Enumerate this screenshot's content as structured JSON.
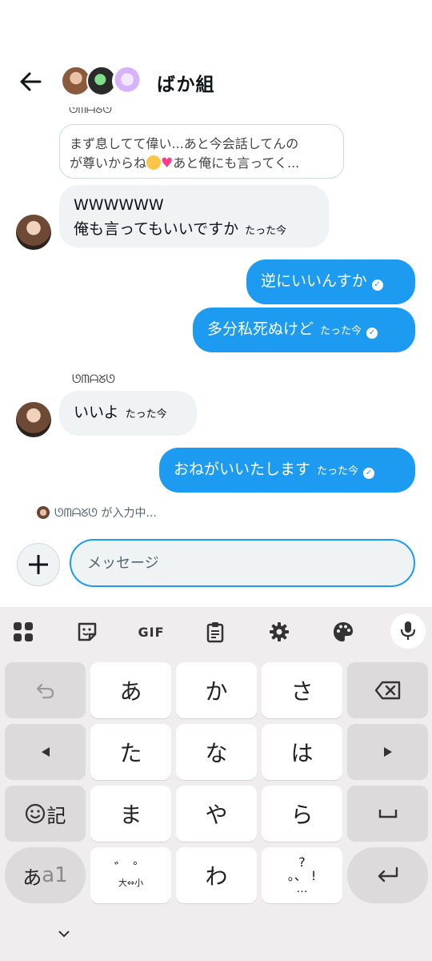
{
  "header": {
    "back_icon": "arrow-left-icon",
    "group_name": "ばか組"
  },
  "chat": {
    "clipped_name": "ᘎᗰᗩᘜᘎ",
    "reply_quote": {
      "line1": "まず息してて偉い...あと今会話してんの",
      "line2_pre": "が尊いからね",
      "line2_post": "あと俺にも言ってく..."
    },
    "messages": [
      {
        "dir": "in",
        "lines": [
          "WWWWWW",
          "俺も言ってもいいですか"
        ],
        "time": "たった今"
      },
      {
        "dir": "out",
        "text": "逆にいいんすか",
        "time": ""
      },
      {
        "dir": "out",
        "text": "多分私死ぬけど",
        "time": "たった今"
      },
      {
        "dir": "in",
        "sender": "ᘎᗰᗩᘜᘎ",
        "text": "いいよ",
        "time": "たった今"
      },
      {
        "dir": "out",
        "text": "おねがいいたします",
        "time": "たった今"
      }
    ]
  },
  "typing": {
    "text": "ᘎᗰᗩᘜᘎ が入力中..."
  },
  "composer": {
    "placeholder": "メッセージ",
    "plus_icon": "plus-icon"
  },
  "keyboard": {
    "toolbar": {
      "gif_label": "GIF",
      "icons": [
        "apps-grid-icon",
        "sticker-icon",
        "gif-icon",
        "clipboard-icon",
        "gear-icon",
        "palette-icon",
        "mic-icon"
      ]
    },
    "rows": [
      [
        "undo",
        "あ",
        "か",
        "さ",
        "backspace"
      ],
      [
        "left",
        "た",
        "な",
        "は",
        "right"
      ],
      [
        "emoji",
        "ま",
        "や",
        "ら",
        "space"
      ],
      [
        "mode",
        "dakuten",
        "わ",
        "punct",
        "enter"
      ]
    ],
    "keys": {
      "a": "あ",
      "ka": "か",
      "sa": "さ",
      "ta": "た",
      "na": "な",
      "ha": "は",
      "ma": "ま",
      "ya": "や",
      "ra": "ら",
      "wa": "わ",
      "emoji_label": "記",
      "mode_a": "あ",
      "mode_1": "a1",
      "dakuten_top": "゛ ゜",
      "dakuten_bottom": "大⇔小",
      "punct_top": "?",
      "punct_mid": "。、 !",
      "punct_bottom": "…"
    }
  }
}
